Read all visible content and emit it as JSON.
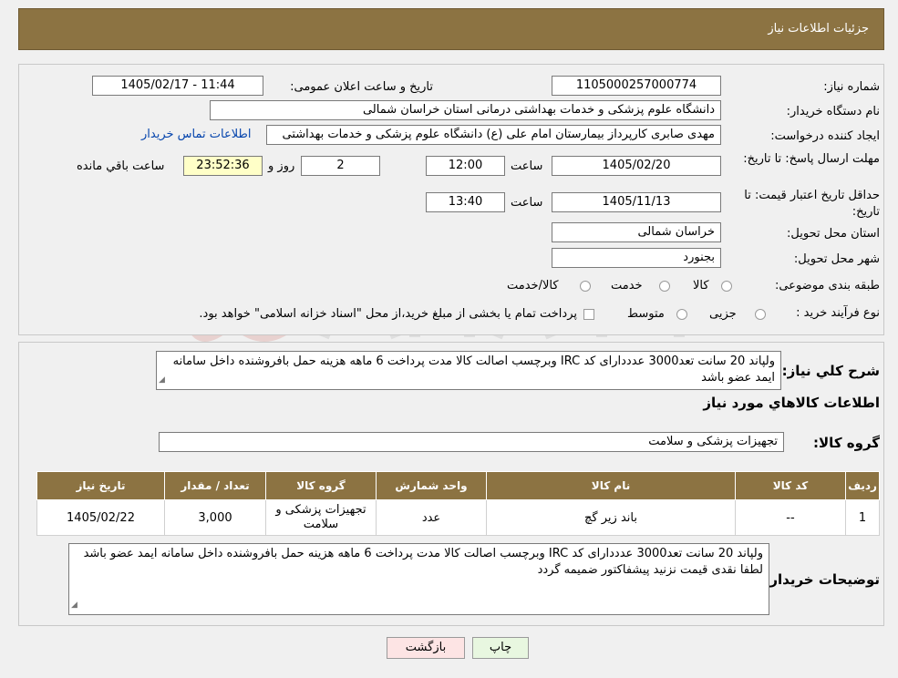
{
  "header": {
    "title": "جزئیات اطلاعات نیاز"
  },
  "form": {
    "need_number_label": "شماره نیاز:",
    "need_number": "1105000257000774",
    "announce_label": "تاریخ و ساعت اعلان عمومی:",
    "announce_value": "1405/02/17 - 11:44",
    "buyer_org_label": "نام دستگاه خریدار:",
    "buyer_org": "دانشگاه علوم پزشکی و خدمات بهداشتی درمانی استان خراسان شمالی",
    "creator_label": "ایجاد کننده درخواست:",
    "creator": "مهدی صابری کارپرداز بیمارستان امام علی (ع) دانشگاه علوم پزشکی و خدمات بهداشتی",
    "contact_link": "اطلاعات تماس خریدار",
    "deadline_label": "مهلت ارسال پاسخ: تا تاریخ:",
    "deadline_date": "1405/02/20",
    "time_label": "ساعت",
    "deadline_time": "12:00",
    "days_value": "2",
    "days_label": "روز و",
    "remaining_time": "23:52:36",
    "remaining_label": "ساعت باقي مانده",
    "validity_label": "حداقل تاریخ اعتبار قیمت: تا تاریخ:",
    "validity_date": "1405/11/13",
    "validity_time": "13:40",
    "province_label": "استان محل تحویل:",
    "province": "خراسان شمالی",
    "city_label": "شهر محل تحویل:",
    "city": "بجنورد",
    "category_label": "طبقه بندی موضوعی:",
    "category_options": [
      "کالا",
      "خدمت",
      "کالا/خدمت"
    ],
    "process_label": "نوع فرآیند خرید :",
    "process_options": [
      "جزیی",
      "متوسط"
    ],
    "process_note": "پرداخت تمام یا بخشی از مبلغ خرید،از محل \"اسناد خزانه اسلامی\" خواهد بود."
  },
  "summary": {
    "label": "شرح کلي نياز:",
    "text": "ولپاند 20 سانت تعد3000 عدددارای کد IRC وبرچسب اصالت  کالا مدت پرداخت 6 ماهه هزینه حمل بافروشنده داخل سامانه ایمد عضو باشد"
  },
  "goods": {
    "section_title": "اطلاعات کالاهاي مورد نياز",
    "group_label": "گروه کالا:",
    "group_value": "تجهیزات پزشکی و سلامت",
    "columns": [
      "رديف",
      "کد کالا",
      "نام کالا",
      "واحد شمارش",
      "گروه کالا",
      "تعداد / مقدار",
      "تاریخ نیاز"
    ],
    "rows": [
      [
        "1",
        "--",
        "باند زیر گچ",
        "عدد",
        "تجهیزات پزشکی و سلامت",
        "3,000",
        "1405/02/22"
      ]
    ]
  },
  "buyer_notes": {
    "label": "توضیحات خریدار:",
    "text": "ولپاند 20 سانت تعد3000 عدددارای کد IRC وبرچسب اصالت  کالا مدت پرداخت 6 ماهه هزینه حمل بافروشنده داخل سامانه ایمد عضو باشد لطفا نقدی قیمت نزنید پیشفاکتور ضمیمه گردد"
  },
  "buttons": {
    "print": "چاپ",
    "back": "بازگشت"
  },
  "colors": {
    "header": "#8c7342",
    "yellow_box": "#ffffc8",
    "print_button": "#e8f7e0",
    "back_button": "#fde4e4",
    "link": "#0645ad"
  }
}
